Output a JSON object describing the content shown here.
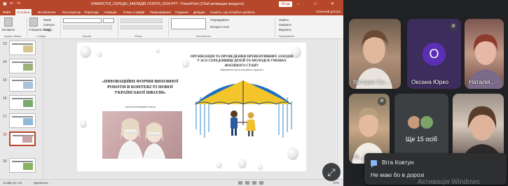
{
  "ppt": {
    "window_title": "ІНАВІЯСТІЯ_СЕРЕДН_ЗАКЛАДІВ ОСВІТИ_2024.PPT - PowerPoint (Сбой активации продукта)",
    "signin_label": "Вход",
    "user_name": "Світлана Пустохіна",
    "tabs": [
      "Файл",
      "Основна",
      "Вставлення",
      "Конструктор",
      "Переходи",
      "Анімація",
      "Показ слайдів",
      "Рецензування",
      "Подання",
      "Довідка",
      "Скажіть, що потрібно зробити"
    ],
    "active_tab": "Основна",
    "share_label": "Спільний доступ",
    "ribbon": {
      "paste": "Вставити",
      "new_slide": "Створити слайд",
      "layout": "Макет",
      "reset": "Скинути",
      "section": "Розділ",
      "groups": [
        "Буфер обміну",
        "Слайди",
        "Шрифт",
        "Абзац",
        "Малювання",
        "Редагування"
      ],
      "find": "Знайти",
      "replace": "Замінити",
      "select": "Виділити",
      "arrange": "Упорядкувати",
      "quick_styles": "Експрес-стилі"
    },
    "thumb_numbers": [
      "13",
      "14",
      "15",
      "16",
      "17",
      "18",
      "19"
    ],
    "status": {
      "slide_no": "Слайд 18 з 19",
      "language": "українська",
      "zoom": "67%"
    }
  },
  "slide": {
    "left_title": "«ІННОВАЦІЙНІ ФОРМИ ВИХОВНОЇ РОБОТИ В КОНТЕКСТІ НОВОЇ УКРАЇНСЬКОЇ ШКОЛИ»",
    "left_sub": "Сучасна інноваційна школа",
    "right_title": "ОРГАНІЗАЦІЯ ТА ПРОВЕДЕННЯ ПРЕВЕНТИВНИХ ЗАХОДІВ У ЗСО СЕРЕДОВИЩІ ДІТЕЙ ТА МОЛОДІ В УМОВАХ ВОЄННОГО СТАНУ",
    "right_sub": "збереження психо-емоційного здоров'я"
  },
  "participants": {
    "viktoria": "Вікторія Се...",
    "oksana": "Оксана Юрко",
    "oksana_initial": "О",
    "natalia": "Наталія...",
    "nina": "Ні...",
    "more": "Ще 15 осіб"
  },
  "toast": {
    "sender": "Віта Ковтун",
    "message": "Не маю бо в дорозі"
  },
  "watermark": "Активація Windows",
  "colors": {
    "ppt_accent": "#b7472a",
    "meet_bg": "#202124",
    "avatar_purple": "#5b2fb5"
  }
}
